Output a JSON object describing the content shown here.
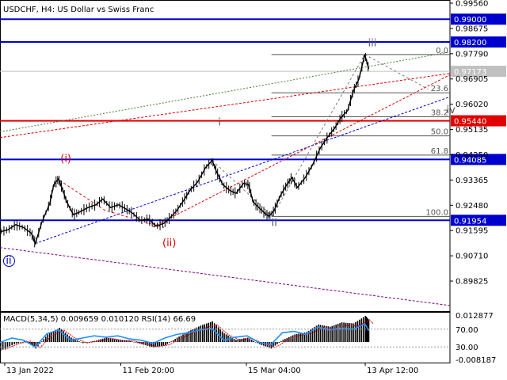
{
  "chart_data": {
    "type": "line",
    "title": "USDCHF, H4:  US Dollar vs Swiss Franc",
    "symbol": "USDCHF",
    "timeframe": "H4",
    "ylim": [
      0.888,
      0.9956
    ],
    "price_ticks": [
      "0.99560",
      "0.98675",
      "0.97790",
      "0.96905",
      "0.96020",
      "0.95135",
      "0.94250",
      "0.93365",
      "0.92480",
      "0.91595",
      "0.90710",
      "0.89825"
    ],
    "time_ticks": [
      {
        "label": "13 Jan 2022",
        "t": 0
      },
      {
        "label": "11 Feb 20:00",
        "t": 29.6
      },
      {
        "label": "15 Mar 04:00",
        "t": 61.6
      },
      {
        "label": "13 Apr 12:00",
        "t": 91.9
      }
    ],
    "time_range": [
      -1.2,
      113.5
    ],
    "last_price": {
      "label": "0.97173",
      "value": 0.97173,
      "color": "#c0c0c0"
    },
    "levels": [
      {
        "label": "0.99000",
        "value": 0.99,
        "color": "#0000cd"
      },
      {
        "label": "0.98200",
        "value": 0.982,
        "color": "#0000cd"
      },
      {
        "label": "0.95440",
        "value": 0.9544,
        "color": "#e00000"
      },
      {
        "label": "0.94085",
        "value": 0.94085,
        "color": "#0000cd"
      },
      {
        "label": "0.91954",
        "value": 0.91954,
        "color": "#0000cd"
      }
    ],
    "fibo": {
      "color": "#555555",
      "t_start": 68.0,
      "t_end": 113.5,
      "levels": [
        {
          "label": "0.0",
          "value": 0.9776
        },
        {
          "label": "23.6",
          "value": 0.9642
        },
        {
          "label": "38.2",
          "value": 0.9558
        },
        {
          "label": "50.0",
          "value": 0.9491
        },
        {
          "label": "61.8",
          "value": 0.9424
        },
        {
          "label": "100.0",
          "value": 0.9209
        }
      ]
    },
    "wave_labels": [
      {
        "label": "(i)",
        "t": 14.2,
        "value": 0.94,
        "color": "#e00000",
        "circled": false
      },
      {
        "label": "(ii)",
        "t": 40.2,
        "value": 0.9105,
        "color": "#e00000",
        "circled": false
      },
      {
        "label": "i",
        "t": 54.4,
        "value": 0.9528,
        "color": "#555555",
        "circled": false
      },
      {
        "label": "ii",
        "t": 68.0,
        "value": 0.9175,
        "color": "#555555",
        "circled": false
      },
      {
        "label": "iii",
        "t": 92.6,
        "value": 0.9805,
        "color": "#555555",
        "circled": false
      },
      {
        "label": "iv",
        "t": 112.6,
        "value": 0.957,
        "color": "#555555",
        "circled": false
      },
      {
        "label": "ii",
        "t": 0.3,
        "value": 0.9042,
        "color": "#0000cd",
        "circled": true
      }
    ],
    "trendlines": [
      {
        "color": "#4b7b3b",
        "dash": "2,2",
        "points": [
          [
            -1.2,
            0.9505
          ],
          [
            113.5,
            0.9785
          ]
        ]
      },
      {
        "color": "#e00000",
        "dash": "3,2",
        "points": [
          [
            -1.2,
            0.9485
          ],
          [
            113.5,
            0.971
          ]
        ]
      },
      {
        "color": "#e00000",
        "dash": "3,2",
        "points": [
          [
            37.7,
            0.9172
          ],
          [
            113.5,
            0.9705
          ]
        ]
      },
      {
        "color": "#0000cd",
        "dash": "3,2",
        "points": [
          [
            7.8,
            0.9114
          ],
          [
            113.5,
            0.9628
          ]
        ]
      },
      {
        "color": "#800080",
        "dash": "3,2",
        "points": [
          [
            -1.2,
            0.91
          ],
          [
            113.5,
            0.8897
          ]
        ]
      },
      {
        "color": "#e00000",
        "dash": "3,3",
        "points": [
          [
            14.0,
            0.9335
          ],
          [
            25.6,
            0.923
          ],
          [
            40.6,
            0.917
          ]
        ]
      },
      {
        "color": "#777777",
        "dash": "3,3",
        "points": [
          [
            52.9,
            0.9405
          ],
          [
            68.2,
            0.921
          ]
        ]
      },
      {
        "color": "#777777",
        "dash": "3,3",
        "points": [
          [
            68.2,
            0.921
          ],
          [
            91.8,
            0.9776
          ]
        ]
      },
      {
        "color": "#777777",
        "dash": "3,3",
        "points": [
          [
            91.8,
            0.9776
          ],
          [
            107.9,
            0.9655
          ]
        ]
      }
    ],
    "price_path": [
      [
        -1.2,
        0.9155
      ],
      [
        0.8,
        0.9162
      ],
      [
        2.8,
        0.918
      ],
      [
        4.8,
        0.917
      ],
      [
        6.8,
        0.915
      ],
      [
        7.8,
        0.9114
      ],
      [
        9.5,
        0.919
      ],
      [
        11.5,
        0.9255
      ],
      [
        12.5,
        0.932
      ],
      [
        13.7,
        0.934
      ],
      [
        14.6,
        0.931
      ],
      [
        15.8,
        0.926
      ],
      [
        17.5,
        0.9215
      ],
      [
        19.2,
        0.9225
      ],
      [
        21.2,
        0.924
      ],
      [
        23.3,
        0.925
      ],
      [
        25.0,
        0.927
      ],
      [
        27.0,
        0.924
      ],
      [
        29.0,
        0.925
      ],
      [
        30.9,
        0.9235
      ],
      [
        32.6,
        0.922
      ],
      [
        34.6,
        0.9195
      ],
      [
        36.6,
        0.92
      ],
      [
        38.6,
        0.9175
      ],
      [
        40.6,
        0.9185
      ],
      [
        42.2,
        0.9205
      ],
      [
        43.9,
        0.923
      ],
      [
        45.6,
        0.9265
      ],
      [
        47.2,
        0.93
      ],
      [
        49.2,
        0.933
      ],
      [
        51.2,
        0.938
      ],
      [
        52.9,
        0.9405
      ],
      [
        54.0,
        0.9365
      ],
      [
        55.6,
        0.932
      ],
      [
        57.4,
        0.93
      ],
      [
        59.0,
        0.929
      ],
      [
        60.9,
        0.9325
      ],
      [
        62.2,
        0.932
      ],
      [
        63.3,
        0.926
      ],
      [
        64.8,
        0.924
      ],
      [
        66.3,
        0.922
      ],
      [
        67.4,
        0.921
      ],
      [
        68.7,
        0.923
      ],
      [
        70.2,
        0.928
      ],
      [
        71.9,
        0.932
      ],
      [
        73.2,
        0.9345
      ],
      [
        74.6,
        0.931
      ],
      [
        76.6,
        0.9345
      ],
      [
        78.5,
        0.939
      ],
      [
        80.5,
        0.945
      ],
      [
        82.5,
        0.949
      ],
      [
        84.2,
        0.952
      ],
      [
        85.7,
        0.9555
      ],
      [
        87.4,
        0.958
      ],
      [
        88.9,
        0.965
      ],
      [
        90.3,
        0.969
      ],
      [
        91.8,
        0.9776
      ],
      [
        92.8,
        0.9725
      ]
    ],
    "indicator": {
      "label": "MACD(5,34,5) 0.009659 0.010120 RSI(14) 66.69",
      "y_ticks": [
        {
          "label": "0.012877",
          "value": 0.012877
        },
        {
          "label": "70.00",
          "value": 70
        },
        {
          "label": "30.00",
          "value": 30
        },
        {
          "label": "-0.008187",
          "value": -0.008187
        }
      ],
      "macd_max": 0.012877,
      "macd_min": -0.008187,
      "rsi_color": "#1e90ff",
      "signal_color": "#e00000",
      "hist_color": "#000000",
      "macd_path": [
        [
          -1.2,
          -0.004
        ],
        [
          2.3,
          -0.001
        ],
        [
          5.3,
          0.0005
        ],
        [
          7.8,
          -0.003
        ],
        [
          10.8,
          0.0035
        ],
        [
          13.8,
          0.0065
        ],
        [
          16.8,
          0.002
        ],
        [
          19.8,
          -0.0005
        ],
        [
          22.8,
          0.0005
        ],
        [
          25.8,
          0.002
        ],
        [
          28.8,
          0.001
        ],
        [
          31.8,
          0.0005
        ],
        [
          34.8,
          -0.001
        ],
        [
          37.8,
          -0.0025
        ],
        [
          40.8,
          -0.0015
        ],
        [
          43.8,
          0.002
        ],
        [
          46.8,
          0.005
        ],
        [
          49.8,
          0.0075
        ],
        [
          52.8,
          0.0095
        ],
        [
          55.8,
          0.004
        ],
        [
          58.8,
          0.001
        ],
        [
          61.8,
          0.002
        ],
        [
          64.8,
          -0.001
        ],
        [
          67.8,
          -0.003
        ],
        [
          70.8,
          0.001
        ],
        [
          73.8,
          0.0035
        ],
        [
          76.8,
          0.0045
        ],
        [
          79.8,
          0.008
        ],
        [
          82.8,
          0.007
        ],
        [
          85.8,
          0.009
        ],
        [
          88.8,
          0.0085
        ],
        [
          91.8,
          0.012
        ],
        [
          92.8,
          0.0097
        ]
      ],
      "rsi_path": [
        [
          -1.2,
          40
        ],
        [
          1.8,
          50
        ],
        [
          4.8,
          45
        ],
        [
          7.8,
          30
        ],
        [
          10.8,
          60
        ],
        [
          13.8,
          68
        ],
        [
          16.8,
          45
        ],
        [
          19.8,
          50
        ],
        [
          22.8,
          55
        ],
        [
          25.8,
          52
        ],
        [
          28.8,
          55
        ],
        [
          31.8,
          48
        ],
        [
          34.8,
          45
        ],
        [
          37.8,
          38
        ],
        [
          40.8,
          50
        ],
        [
          43.8,
          58
        ],
        [
          46.8,
          62
        ],
        [
          49.8,
          68
        ],
        [
          52.8,
          72
        ],
        [
          55.8,
          45
        ],
        [
          58.8,
          52
        ],
        [
          61.8,
          55
        ],
        [
          64.8,
          40
        ],
        [
          67.8,
          35
        ],
        [
          70.8,
          62
        ],
        [
          73.8,
          65
        ],
        [
          76.8,
          58
        ],
        [
          79.8,
          75
        ],
        [
          82.8,
          68
        ],
        [
          85.8,
          72
        ],
        [
          88.8,
          70
        ],
        [
          91.8,
          82
        ],
        [
          92.8,
          66.69
        ]
      ]
    }
  }
}
